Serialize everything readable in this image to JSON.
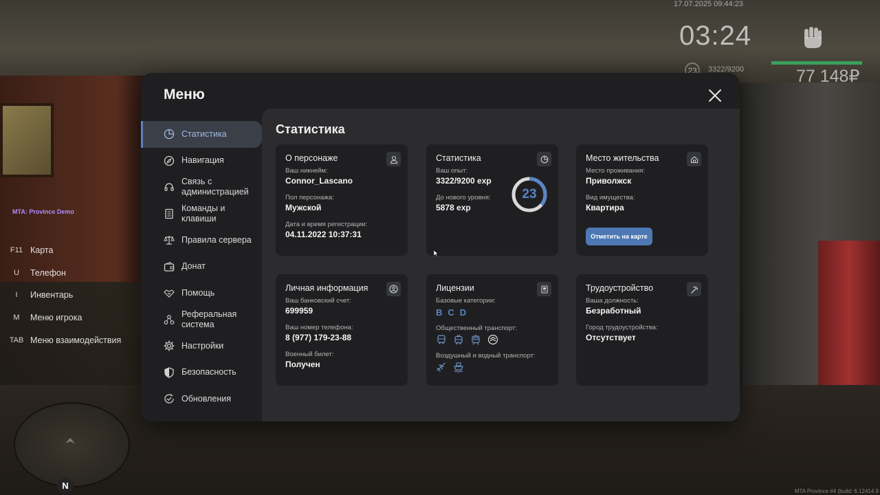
{
  "hud": {
    "datetime": "17.07.2025 09:44:23",
    "clock": "03:24",
    "level": "23",
    "exp": "3322/9200",
    "money": "77 148₽",
    "server_label": "MTA: Province Demo",
    "build_info": "MTA Province #4 (build: 6.12414.9"
  },
  "hotkeys": [
    {
      "key": "F11",
      "label": "Карта"
    },
    {
      "key": "U",
      "label": "Телефон"
    },
    {
      "key": "I",
      "label": "Инвентарь"
    },
    {
      "key": "M",
      "label": "Меню игрока"
    },
    {
      "key": "TAB",
      "label": "Меню взаимодействия"
    }
  ],
  "minimap": {
    "north": "N"
  },
  "menu": {
    "title": "Меню",
    "sidebar": [
      {
        "label": "Статистика",
        "icon": "pie-chart-icon",
        "active": true
      },
      {
        "label": "Навигация",
        "icon": "compass-icon"
      },
      {
        "label": "Связь с администрацией",
        "icon": "headset-icon"
      },
      {
        "label": "Команды и клавиши",
        "icon": "document-icon"
      },
      {
        "label": "Правила сервера",
        "icon": "scales-icon"
      },
      {
        "label": "Донат",
        "icon": "wallet-icon"
      },
      {
        "label": "Помощь",
        "icon": "handshake-icon"
      },
      {
        "label": "Реферальная система",
        "icon": "referral-icon"
      },
      {
        "label": "Настройки",
        "icon": "gear-icon"
      },
      {
        "label": "Безопасность",
        "icon": "shield-icon"
      },
      {
        "label": "Обновления",
        "icon": "update-check-icon"
      }
    ]
  },
  "content": {
    "title": "Статистика",
    "character": {
      "title": "О персонаже",
      "nickname_label": "Ваш никнейм:",
      "nickname": "Connor_Lascano",
      "gender_label": "Пол персонажа:",
      "gender": "Мужской",
      "reg_label": "Дата и время регистрации:",
      "reg": "04.11.2022 10:37:31"
    },
    "stats": {
      "title": "Статистика",
      "exp_label": "Ваш опыт:",
      "exp": "3322/9200 exp",
      "next_label": "До нового уровня:",
      "next": "5878 exp",
      "level": "23",
      "progress": 0.361
    },
    "residence": {
      "title": "Место жительства",
      "place_label": "Место проживания:",
      "place": "Приволжск",
      "property_label": "Вид имущества:",
      "property": "Квартира",
      "mark_button": "Отметить на карте"
    },
    "personal": {
      "title": "Личная информация",
      "bank_label": "Ваш банковский счет:",
      "bank": "699959",
      "phone_label": "Ваш номер телефона:",
      "phone": "8 (977) 179-23-88",
      "military_label": "Военный билет:",
      "military": "Получен"
    },
    "licenses": {
      "title": "Лицензии",
      "base_label": "Базовые категории:",
      "base_categories": [
        "B",
        "C",
        "D"
      ],
      "public_label": "Общественный транспорт:",
      "air_water_label": "Воздушный и водный транспорт:"
    },
    "employment": {
      "title": "Трудоустройство",
      "position_label": "Ваша должность:",
      "position": "Безработный",
      "workplace_label": "Город трудоустройства:",
      "workplace": "Отсутствует"
    }
  },
  "colors": {
    "accent": "#5b84c4",
    "button": "#4e78b4",
    "panel": "#1f1f21",
    "content_bg": "#2c2c2e",
    "health": "#3aa05a"
  }
}
